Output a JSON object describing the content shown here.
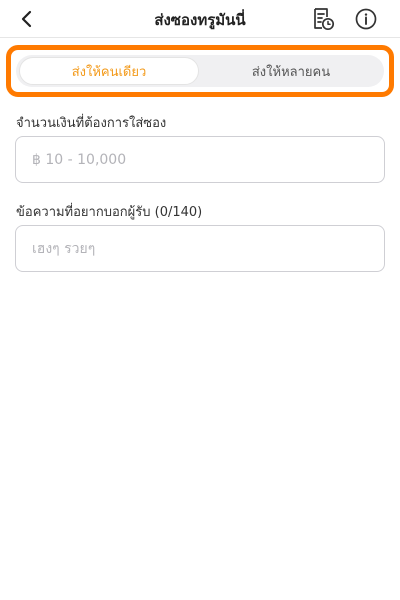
{
  "header": {
    "title": "ส่งซองทรูมันนี่"
  },
  "tabs": [
    {
      "label": "ส่งให้คนเดียว",
      "active": true
    },
    {
      "label": "ส่งให้หลายคน",
      "active": false
    }
  ],
  "amount": {
    "label": "จำนวนเงินที่ต้องการใส่ซอง",
    "placeholder": "฿ 10 - 10,000"
  },
  "message": {
    "label": "ข้อความที่อยากบอกผู้รับ (0/140)",
    "placeholder": "เฮงๆ รวยๆ"
  },
  "colors": {
    "accent": "#f39a1a",
    "highlight_frame": "#ff7a00"
  },
  "icons": {
    "back": "chevron-left-icon",
    "history": "history-icon",
    "info": "info-icon"
  }
}
